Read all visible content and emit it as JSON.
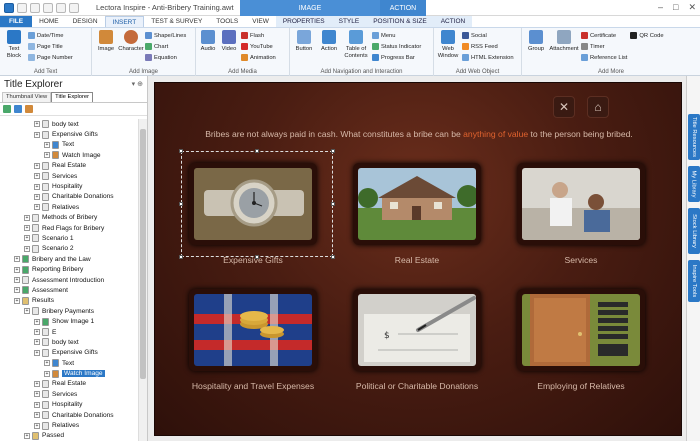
{
  "app": {
    "title": "Lectora Inspire - Anti-Bribery Training.awt",
    "context_image": "IMAGE",
    "context_action": "ACTION",
    "window_controls": [
      "–",
      "□",
      "✕"
    ]
  },
  "tabs": [
    "FILE",
    "HOME",
    "DESIGN",
    "INSERT",
    "TEST & SURVEY",
    "TOOLS",
    "VIEW",
    "PROPERTIES",
    "STYLE",
    "POSITION & SIZE",
    "ACTION"
  ],
  "active_tab": "INSERT",
  "ribbon": {
    "add_text": {
      "label": "Add Text",
      "text_block": "Text Block",
      "items": [
        "Date/Time",
        "Page Title",
        "Page Number"
      ]
    },
    "add_image": {
      "label": "Add Image",
      "image": "Image",
      "character": "Character",
      "items": [
        "Shape/Lines",
        "Chart",
        "Equation"
      ]
    },
    "add_media": {
      "label": "Add Media",
      "audio": "Audio",
      "video": "Video",
      "items": [
        "Flash",
        "YouTube",
        "Animation"
      ]
    },
    "add_nav": {
      "label": "Add Navigation and Interaction",
      "button": "Button",
      "action": "Action",
      "toc": "Table of Contents",
      "items": [
        "Menu",
        "Status Indicator",
        "Progress Bar"
      ]
    },
    "add_web": {
      "label": "Add Web Object",
      "web_window": "Web Window",
      "items": [
        "Social",
        "RSS Feed",
        "HTML Extension"
      ]
    },
    "add_more": {
      "label": "Add More",
      "group": "Group",
      "attachment": "Attachment",
      "items": [
        "Certificate",
        "Timer",
        "Reference List"
      ],
      "qr": "QR Code"
    }
  },
  "left_panel": {
    "title": "Title Explorer",
    "tabs": [
      "Thumbnail View",
      "Title Explorer"
    ],
    "tree": [
      {
        "label": "body text",
        "indent": 3,
        "icon": "page"
      },
      {
        "label": "Expensive Gifts",
        "indent": 3,
        "icon": "page"
      },
      {
        "label": "Text",
        "indent": 4,
        "icon": "text"
      },
      {
        "label": "Watch Image",
        "indent": 4,
        "icon": "image"
      },
      {
        "label": "Real Estate",
        "indent": 3,
        "icon": "page"
      },
      {
        "label": "Services",
        "indent": 3,
        "icon": "page"
      },
      {
        "label": "Hospitality",
        "indent": 3,
        "icon": "page"
      },
      {
        "label": "Charitable Donations",
        "indent": 3,
        "icon": "page"
      },
      {
        "label": "Relatives",
        "indent": 3,
        "icon": "page"
      },
      {
        "label": "Methods of Bribery",
        "indent": 2,
        "icon": "page"
      },
      {
        "label": "Red Flags for Bribery",
        "indent": 2,
        "icon": "page"
      },
      {
        "label": "Scenario 1",
        "indent": 2,
        "icon": "page"
      },
      {
        "label": "Scenario 2",
        "indent": 2,
        "icon": "page"
      },
      {
        "label": "Bribery and the Law",
        "indent": 1,
        "icon": "chapter"
      },
      {
        "label": "Reporting Bribery",
        "indent": 1,
        "icon": "chapter"
      },
      {
        "label": "Assessment Introduction",
        "indent": 1,
        "icon": "page"
      },
      {
        "label": "Assessment",
        "indent": 1,
        "icon": "chapter"
      },
      {
        "label": "Results",
        "indent": 1,
        "icon": "folder"
      },
      {
        "label": "Bribery Payments",
        "indent": 2,
        "icon": "page"
      },
      {
        "label": "Show Image 1",
        "indent": 3,
        "icon": "chapter"
      },
      {
        "label": "E",
        "indent": 3,
        "icon": "page"
      },
      {
        "label": "body text",
        "indent": 3,
        "icon": "page"
      },
      {
        "label": "Expensive Gifts",
        "indent": 3,
        "icon": "page"
      },
      {
        "label": "Text",
        "indent": 4,
        "icon": "text"
      },
      {
        "label": "Watch Image",
        "indent": 4,
        "icon": "image",
        "selected": true
      },
      {
        "label": "Real Estate",
        "indent": 3,
        "icon": "page"
      },
      {
        "label": "Services",
        "indent": 3,
        "icon": "page"
      },
      {
        "label": "Hospitality",
        "indent": 3,
        "icon": "page"
      },
      {
        "label": "Charitable Donations",
        "indent": 3,
        "icon": "page"
      },
      {
        "label": "Relatives",
        "indent": 3,
        "icon": "page"
      },
      {
        "label": "Passed",
        "indent": 2,
        "icon": "folder"
      }
    ]
  },
  "stage": {
    "prefix": "Bribes are not always paid in cash. What constitutes a bribe can be ",
    "highlight": "anything of value",
    "suffix": " to the person being bribed.",
    "tiles": [
      {
        "label": "Expensive Gifts",
        "image": "watch-image"
      },
      {
        "label": "Real Estate",
        "image": "house-image"
      },
      {
        "label": "Services",
        "image": "barber-image"
      },
      {
        "label": "Hospitality and Travel Expenses",
        "image": "casino-image"
      },
      {
        "label": "Political or Charitable Donations",
        "image": "check-image"
      },
      {
        "label": "Employing of Relatives",
        "image": "office-door-image"
      }
    ]
  },
  "side_tabs": [
    "Title Resources",
    "My Library",
    "Stock Library",
    "Inspire Tools"
  ]
}
